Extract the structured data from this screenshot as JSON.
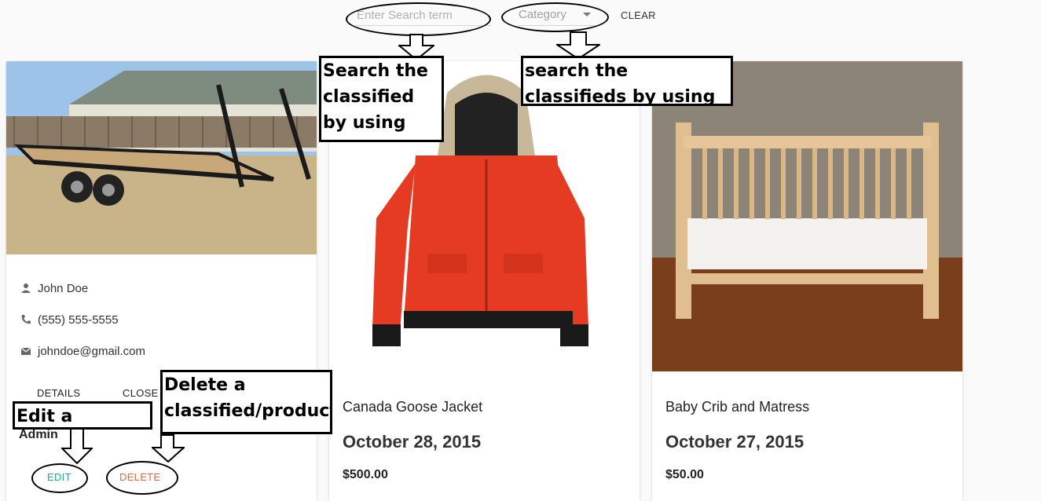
{
  "search": {
    "placeholder": "Enter Search term"
  },
  "category": {
    "label": "Category"
  },
  "toolbar": {
    "clear_label": "CLEAR"
  },
  "cards": [
    {
      "contact": {
        "name": "John Doe",
        "phone": "(555) 555-5555",
        "email": "johndoe@gmail.com"
      },
      "actions": {
        "details": "DETAILS",
        "close": "CLOSE",
        "admin": "Admin",
        "edit": "EDIT",
        "delete": "DELETE"
      }
    },
    {
      "title": "Canada Goose Jacket",
      "date": "October 28, 2015",
      "price": "$500.00"
    },
    {
      "title": "Baby Crib and Matress",
      "date": "October 27, 2015",
      "price": "$50.00"
    }
  ],
  "annotations": {
    "search_text": "Search the classified by using text.",
    "search_category": "search the classifieds by using categories.",
    "edit": "Edit a Classified",
    "delete": "Delete a classified/product."
  },
  "icons": [
    "person-icon",
    "phone-icon",
    "email-icon",
    "dropdown-caret-icon"
  ],
  "colors": {
    "edit": "#26a69a",
    "delete": "#e8643b",
    "background": "#fafafa"
  }
}
